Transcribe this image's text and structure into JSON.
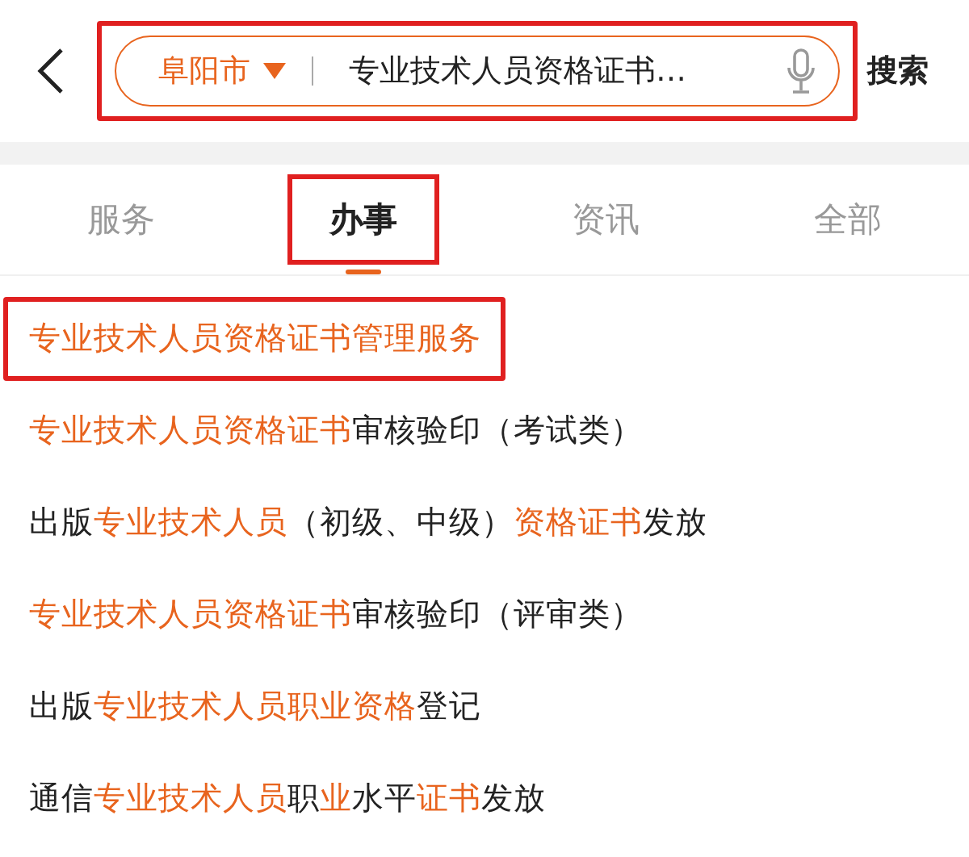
{
  "search": {
    "city": "阜阳市",
    "value": "专业技术人员资格证书…",
    "button": "搜索",
    "highlighted": true
  },
  "tabs": [
    {
      "label": "服务",
      "selected": false,
      "highlighted": false
    },
    {
      "label": "办事",
      "selected": true,
      "highlighted": true
    },
    {
      "label": "资讯",
      "selected": false,
      "highlighted": false
    },
    {
      "label": "全部",
      "selected": false,
      "highlighted": false
    }
  ],
  "results": [
    {
      "highlighted": true,
      "segments": [
        {
          "text": "专业技术人员资格证书管理服务",
          "match": true
        }
      ]
    },
    {
      "highlighted": false,
      "segments": [
        {
          "text": "专业技术人员资格证书",
          "match": true
        },
        {
          "text": "审核验印（考试类）",
          "match": false
        }
      ]
    },
    {
      "highlighted": false,
      "segments": [
        {
          "text": "出版",
          "match": false
        },
        {
          "text": "专业技术人员",
          "match": true
        },
        {
          "text": "（初级、中级）",
          "match": false
        },
        {
          "text": "资格证书",
          "match": true
        },
        {
          "text": "发放",
          "match": false
        }
      ]
    },
    {
      "highlighted": false,
      "segments": [
        {
          "text": "专业技术人员资格证书",
          "match": true
        },
        {
          "text": "审核验印（评审类）",
          "match": false
        }
      ]
    },
    {
      "highlighted": false,
      "segments": [
        {
          "text": "出版",
          "match": false
        },
        {
          "text": "专业技术人员职业资格",
          "match": true
        },
        {
          "text": "登记",
          "match": false
        }
      ]
    },
    {
      "highlighted": false,
      "segments": [
        {
          "text": "通信",
          "match": false
        },
        {
          "text": "专业技术人员",
          "match": true
        },
        {
          "text": "职",
          "match": false
        },
        {
          "text": "业",
          "match": true
        },
        {
          "text": "水平",
          "match": false
        },
        {
          "text": "证书",
          "match": true
        },
        {
          "text": "发放",
          "match": false
        }
      ]
    }
  ]
}
